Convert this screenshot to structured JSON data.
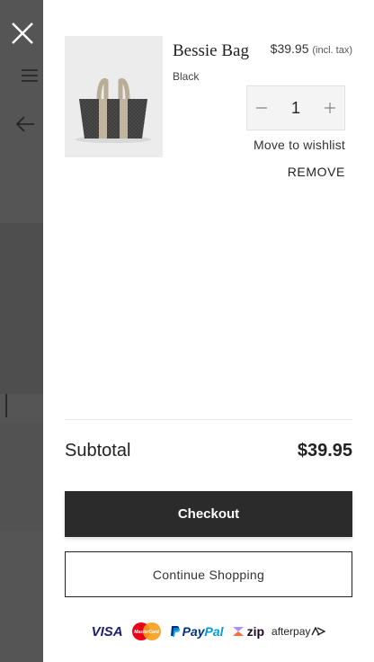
{
  "cart": {
    "item": {
      "name": "Bessie Bag",
      "variant": "Black",
      "price": "$39.95",
      "tax_note": "(incl. tax)",
      "quantity": "1",
      "wishlist_label": "Move to wishlist",
      "remove_label": "REMOVE"
    },
    "subtotal_label": "Subtotal",
    "subtotal_value": "$39.95",
    "checkout_label": "Checkout",
    "continue_label": "Continue Shopping"
  },
  "payments": {
    "visa": "VISA",
    "mastercard": "MasterCard",
    "paypal_a": "Pay",
    "paypal_b": "Pal",
    "zip": "zip",
    "afterpay": "afterpay"
  },
  "colors": {
    "primary_button": "#2b2b2b",
    "overlay": "#555555"
  }
}
